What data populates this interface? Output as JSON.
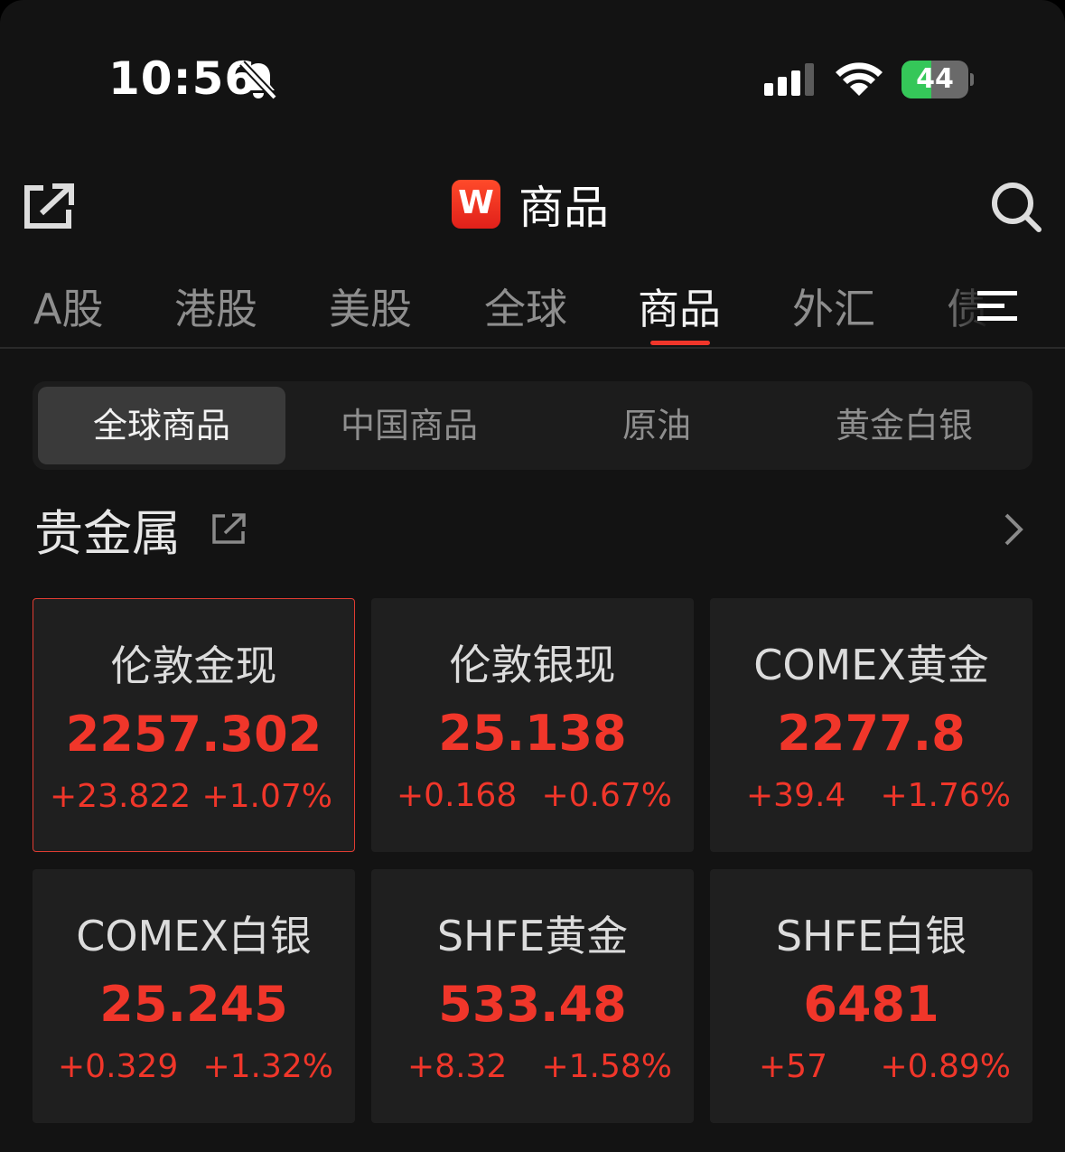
{
  "status": {
    "time": "10:56",
    "battery": "44",
    "battery_level": 0.44
  },
  "header": {
    "logo": "W",
    "title": "商品"
  },
  "tabs": [
    {
      "label": "A股"
    },
    {
      "label": "港股"
    },
    {
      "label": "美股"
    },
    {
      "label": "全球"
    },
    {
      "label": "商品"
    },
    {
      "label": "外汇"
    },
    {
      "label": "债"
    }
  ],
  "active_tab": "商品",
  "segments": [
    {
      "label": "全球商品"
    },
    {
      "label": "中国商品"
    },
    {
      "label": "原油"
    },
    {
      "label": "黄金白银"
    }
  ],
  "active_segment": "全球商品",
  "section": {
    "title": "贵金属"
  },
  "cards": [
    {
      "name": "伦敦金现",
      "price": "2257.302",
      "change": "+23.822",
      "pct": "+1.07%"
    },
    {
      "name": "伦敦银现",
      "price": "25.138",
      "change": "+0.168",
      "pct": "+0.67%"
    },
    {
      "name": "COMEX黄金",
      "price": "2277.8",
      "change": "+39.4",
      "pct": "+1.76%"
    },
    {
      "name": "COMEX白银",
      "price": "25.245",
      "change": "+0.329",
      "pct": "+1.32%"
    },
    {
      "name": "SHFE黄金",
      "price": "533.48",
      "change": "+8.32",
      "pct": "+1.58%"
    },
    {
      "name": "SHFE白银",
      "price": "6481",
      "change": "+57",
      "pct": "+0.89%"
    }
  ],
  "colors": {
    "up": "#f0362a",
    "accent": "#f0362a",
    "battery_green": "#35c759"
  }
}
